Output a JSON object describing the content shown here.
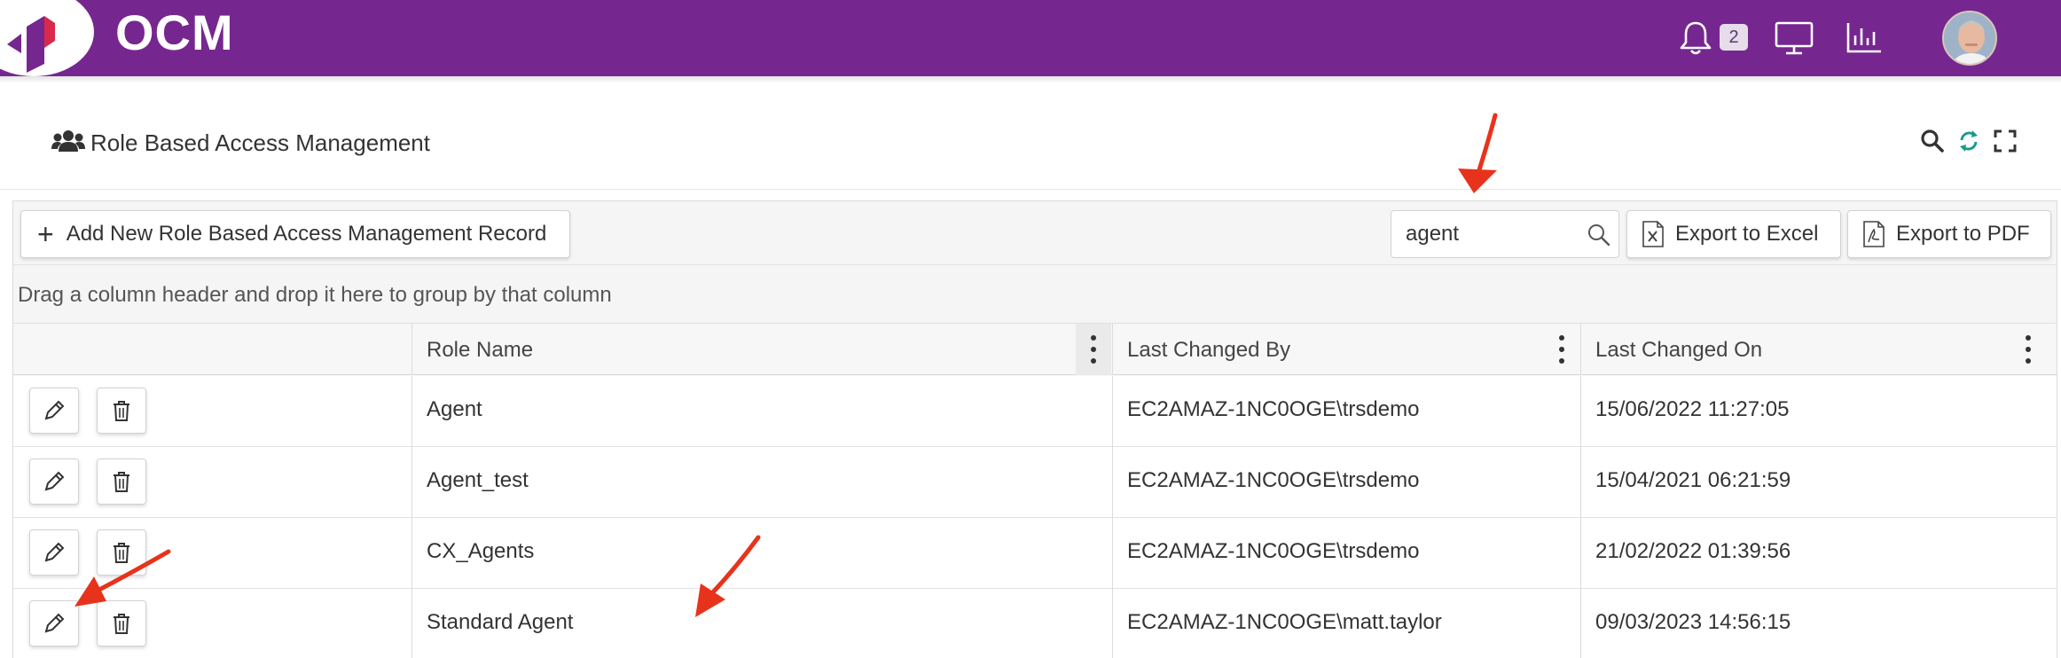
{
  "app": {
    "name": "OCM"
  },
  "topbar": {
    "notification_count": "2"
  },
  "page": {
    "title": "Role Based Access Management"
  },
  "toolbar": {
    "add_label": "Add New Role Based Access Management Record",
    "search_value": "agent",
    "export_excel_label": "Export to Excel",
    "export_pdf_label": "Export to PDF"
  },
  "group_panel": {
    "text": "Drag a column header and drop it here to group by that column"
  },
  "columns": [
    "Role Name",
    "Last Changed By",
    "Last Changed On"
  ],
  "rows": [
    {
      "role_name": "Agent",
      "changed_by": "EC2AMAZ-1NC0OGE\\trsdemo",
      "changed_on": "15/06/2022 11:27:05"
    },
    {
      "role_name": "Agent_test",
      "changed_by": "EC2AMAZ-1NC0OGE\\trsdemo",
      "changed_on": "15/04/2021 06:21:59"
    },
    {
      "role_name": "CX_Agents",
      "changed_by": "EC2AMAZ-1NC0OGE\\trsdemo",
      "changed_on": "21/02/2022 01:39:56"
    },
    {
      "role_name": "Standard Agent",
      "changed_by": "EC2AMAZ-1NC0OGE\\matt.taylor",
      "changed_on": "09/03/2023 14:56:15"
    }
  ],
  "colors": {
    "brand_purple": "#76278f",
    "annotation_red": "#e8331c",
    "refresh_teal": "#1a9b8c"
  },
  "icons": {
    "topbar": [
      "bell-icon",
      "monitor-icon",
      "bar-chart-icon"
    ],
    "header": [
      "users-icon",
      "search-icon",
      "refresh-icon",
      "fullscreen-icon"
    ],
    "row_actions": [
      "pencil-icon",
      "trash-icon"
    ]
  }
}
